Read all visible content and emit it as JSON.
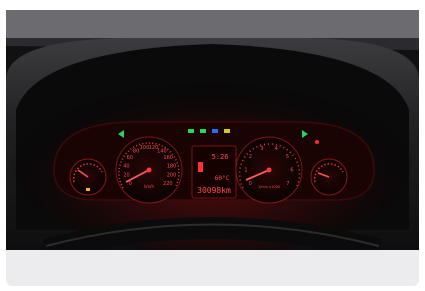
{
  "photo": {
    "subject": "instrument-cluster",
    "speedometer": {
      "ticks": [
        "0",
        "20",
        "40",
        "60",
        "80",
        "100",
        "120",
        "140",
        "160",
        "180",
        "200",
        "220"
      ],
      "unit": "km/h"
    },
    "tachometer": {
      "ticks": [
        "0",
        "1",
        "2",
        "3",
        "4",
        "5",
        "6",
        "7"
      ],
      "unit": "1/min x1000"
    },
    "display": {
      "clock": "5:26",
      "temperature": "60°C",
      "odometer": "30098km"
    },
    "colors": {
      "backlight": "#ff2a2a",
      "indicator_green": "#27d65a",
      "indicator_blue": "#2f6bff"
    }
  }
}
